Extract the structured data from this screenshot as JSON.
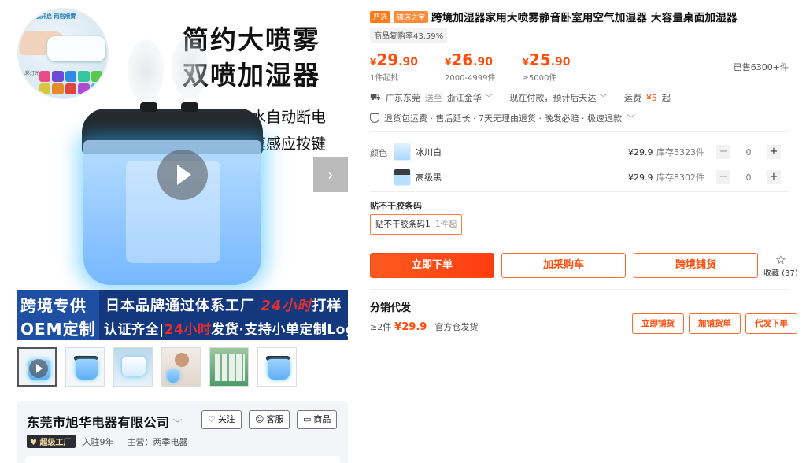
{
  "gallery": {
    "corner_label": "轻触开启 两档喷雾",
    "corner_side_label": "七彩灯光",
    "headline_line1": "简约大喷雾",
    "headline_line2": "双喷加湿器",
    "feature1": "缺水自动断电",
    "feature2": "触摸感应按键",
    "banner_left_line1": "跨境专供",
    "banner_left_line2": "OEM定制",
    "banner_right_line1_a": "日本品牌通过体系工厂",
    "banner_right_line1_b": "24小时",
    "banner_right_line1_c": "打样",
    "banner_right_line2_a": "认证齐全|",
    "banner_right_line2_b": "24小时",
    "banner_right_line2_c": "发货·支持小单定制Logo",
    "next_arrow": "›"
  },
  "shop": {
    "name": "东莞市旭华电器有限公司",
    "chevron": "﹀",
    "follow_label": "关注",
    "service_label": "客服",
    "store_label": "商品",
    "badge": "超级工厂",
    "years": "入驻9年",
    "main_business": "主营：两季电器"
  },
  "product": {
    "tag_yanxuan": "严选",
    "tag_zhendian": "镇店之宝",
    "title": "跨境加湿器家用大喷雾静音卧室用空气加湿器 大容量桌面加湿器",
    "rebuy_rate": "商品复购率43.59%",
    "prices": [
      {
        "currency": "¥",
        "int": "29",
        "dec": ".90",
        "qty": "1件起批"
      },
      {
        "currency": "¥",
        "int": "26",
        "dec": ".90",
        "qty": "2000-4999件"
      },
      {
        "currency": "¥",
        "int": "25",
        "dec": ".90",
        "qty": "≥5000件"
      }
    ],
    "sold": "已售6300+件"
  },
  "shipping": {
    "from": "广东东莞",
    "to_word": "送至",
    "dest": "浙江金华",
    "payment": "现在付款，预计后天达",
    "freight_label": "运费",
    "freight_value": "¥5",
    "freight_suffix": "起"
  },
  "services": {
    "text": "退货包运费 · 售后延长 · 7天无理由退货 · 晚发必赔 · 极速退款"
  },
  "sku": {
    "label": "颜色",
    "items": [
      {
        "name": "冰川白",
        "price": "¥29.9",
        "stock": "库存5323件",
        "qty": "0"
      },
      {
        "name": "高级黑",
        "price": "¥29.9",
        "stock": "库存8302件",
        "qty": "0"
      }
    ],
    "minus": "−",
    "plus": "+"
  },
  "option": {
    "label": "贴不干胶条码",
    "chip": "贴不干胶条码1",
    "chip_sub": "1件起"
  },
  "actions": {
    "buy_now": "立即下单",
    "add_cart": "加采购车",
    "cross_border": "跨境铺货",
    "favorite": "收藏",
    "favorite_count": "(37)"
  },
  "distribution": {
    "title": "分销代发",
    "min_qty": "≥2件",
    "price": "¥29.9",
    "warehouse": "官方仓发货",
    "btn_list": "立即铺货",
    "btn_add": "加铺货单",
    "btn_dropship": "代发下单"
  },
  "colors": {
    "accent": "#ff4c0a",
    "banner_blue": "#14387d"
  }
}
